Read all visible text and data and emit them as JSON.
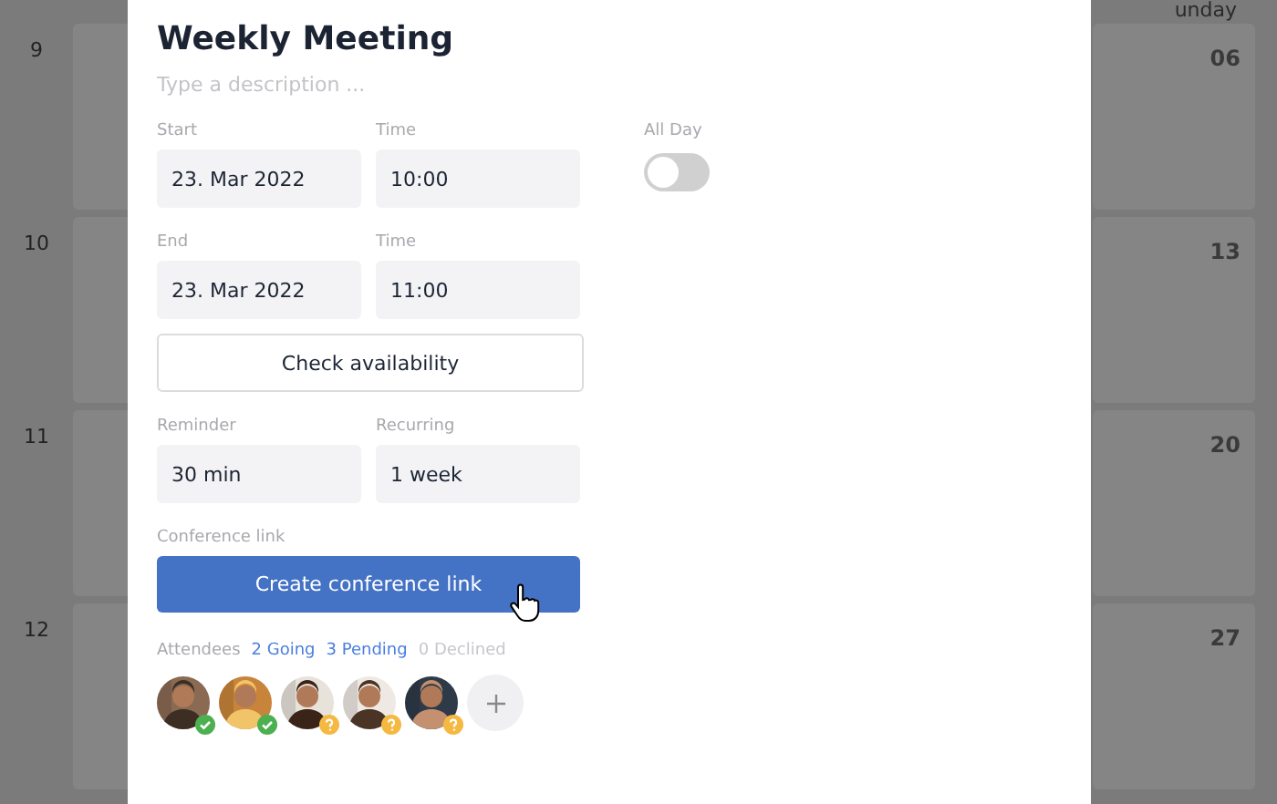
{
  "calendar": {
    "header": "unday",
    "weeks": [
      {
        "number": "9",
        "sunday": "06"
      },
      {
        "number": "10",
        "sunday": "13"
      },
      {
        "number": "11",
        "sunday": "20"
      },
      {
        "number": "12",
        "sunday": "27"
      }
    ]
  },
  "event": {
    "title": "Weekly Meeting",
    "description": {
      "placeholder": "Type a description ..."
    },
    "rows": [
      [
        {
          "label": "Start",
          "value": "23. Mar 2022"
        },
        {
          "label": "Time",
          "value": "10:00"
        }
      ],
      [
        {
          "label": "End",
          "value": "23. Mar 2022"
        },
        {
          "label": "Time",
          "value": "11:00"
        }
      ]
    ],
    "all_day": {
      "label": "All Day",
      "on": false
    },
    "check_button": "Check availability",
    "options": [
      {
        "label": "Reminder",
        "value": "30 min"
      },
      {
        "label": "Recurring",
        "value": "1 week"
      }
    ],
    "conference": {
      "label": "Conference link",
      "button": "Create conference link"
    },
    "attendees": {
      "label": "Attendees",
      "counts": [
        {
          "text": "2 Going",
          "kind": "going"
        },
        {
          "text": "3 Pending",
          "kind": "pending"
        },
        {
          "text": "0 Declined",
          "kind": "declined"
        }
      ],
      "people": [
        {
          "kind": "going"
        },
        {
          "kind": "going"
        },
        {
          "kind": "pending"
        },
        {
          "kind": "pending"
        },
        {
          "kind": "pending"
        }
      ]
    }
  }
}
